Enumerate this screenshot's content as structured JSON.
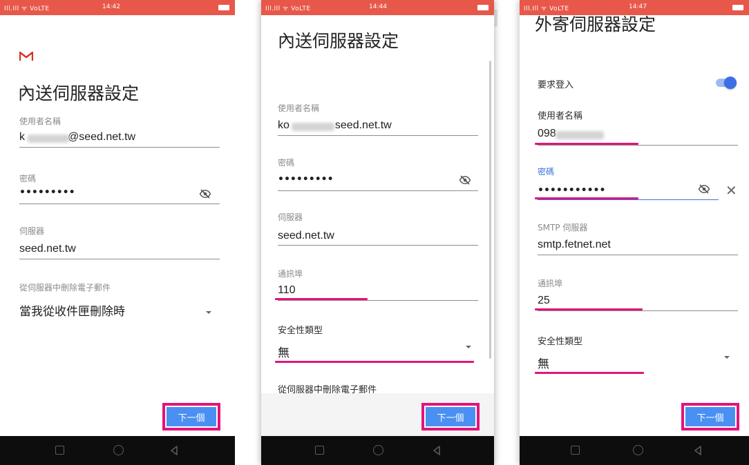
{
  "status": {
    "signal": "Ill.Ill ᯤ VoLTE",
    "times": [
      "14:42",
      "14:44",
      "14:47"
    ]
  },
  "screen1": {
    "title": "內送伺服器設定",
    "username_label": "使用者名稱",
    "username_prefix": "k",
    "username_suffix": "@seed.net.tw",
    "password_label": "密碼",
    "password_value": "•••••••••",
    "server_label": "伺服器",
    "server_value": "seed.net.tw",
    "delete_label": "從伺服器中刪除電子郵件",
    "delete_value": "當我從收件匣刪除時",
    "next_button": "下一個"
  },
  "screen2": {
    "title": "內送伺服器設定",
    "username_label": "使用者名稱",
    "username_prefix": "ko",
    "username_suffix": "seed.net.tw",
    "password_label": "密碼",
    "password_value": "•••••••••",
    "server_label": "伺服器",
    "server_value": "seed.net.tw",
    "port_label": "通訊埠",
    "port_value": "110",
    "security_label": "安全性類型",
    "security_value": "無",
    "delete_label": "從伺服器中刪除電子郵件",
    "next_button": "下一個"
  },
  "screen3": {
    "title": "外寄伺服器設定",
    "require_login_label": "要求登入",
    "username_label": "使用者名稱",
    "username_value": "098",
    "password_label": "密碼",
    "password_value": "•••••••••••",
    "server_label": "SMTP 伺服器",
    "server_value": "smtp.fetnet.net",
    "port_label": "通訊埠",
    "port_value": "25",
    "security_label": "安全性類型",
    "security_value": "無",
    "next_button": "下一個"
  },
  "colors": {
    "statusbar": "#e8584a",
    "highlight": "#e0157a",
    "button": "#4a90f2",
    "accent_blue": "#3a72d8"
  },
  "icons": [
    "gmail-logo",
    "eye-off-icon",
    "dropdown-caret-icon",
    "close-icon",
    "toggle-switch",
    "nav-recents-icon",
    "nav-home-icon",
    "nav-back-icon"
  ]
}
